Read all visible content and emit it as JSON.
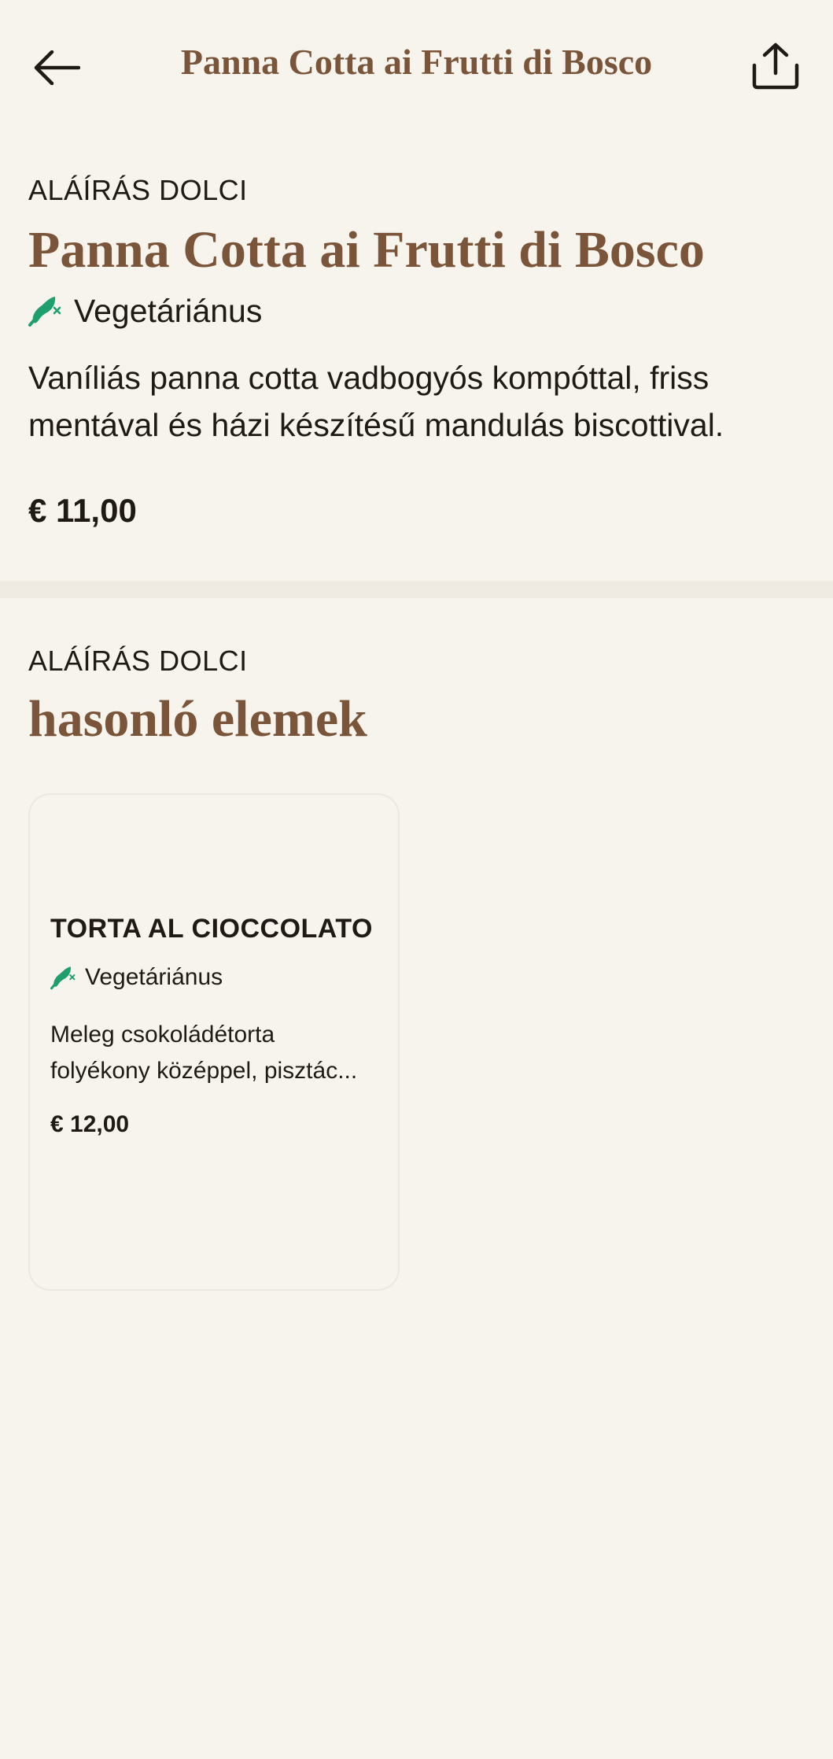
{
  "header": {
    "title": "Panna Cotta ai Frutti di Bosco",
    "back_icon": "arrow-left-icon",
    "share_icon": "share-icon"
  },
  "item": {
    "category": "ALÁÍRÁS DOLCI",
    "name": "Panna Cotta ai Frutti di Bosco",
    "diet_label": "Vegetáriánus",
    "diet_icon": "vegetarian-icon",
    "description": "Vaníliás panna cotta vadbogyós kompóttal, friss mentával és házi készítésű mandulás biscottival.",
    "price": "€ 11,00"
  },
  "similar": {
    "category": "ALÁÍRÁS DOLCI",
    "heading": "hasonló elemek",
    "items": [
      {
        "name": "TORTA AL CIOCCOLATO",
        "diet_label": "Vegetáriánus",
        "description": "Meleg csokoládétorta folyékony középpel, pisztác...",
        "price": "€ 12,00"
      }
    ]
  },
  "colors": {
    "background": "#f7f4ee",
    "accent_brown": "#7a5539",
    "vegetarian_green": "#1f9e6e",
    "text": "#1f1a14"
  }
}
